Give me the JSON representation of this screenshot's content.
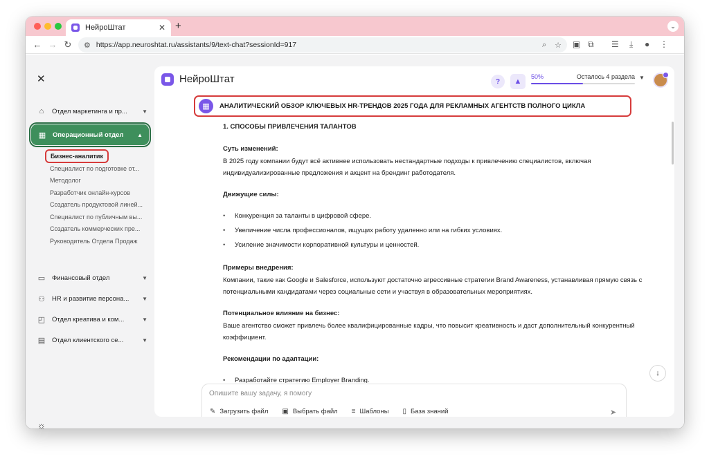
{
  "browser": {
    "tab_title": "НейроШтат",
    "tab_close": "✕",
    "new_tab": "+",
    "url": "https://app.neuroshtat.ru/assistants/9/text-chat?sessionId=917"
  },
  "sidebar": {
    "close_icon": "✕",
    "sections": [
      {
        "label": "Отдел маркетинга и пр...",
        "icon": "shop-icon"
      },
      {
        "label": "Операционный отдел",
        "icon": "grid-icon",
        "active": true
      },
      {
        "label": "Финансовый отдел",
        "icon": "wallet-icon"
      },
      {
        "label": "HR и развитие персона...",
        "icon": "people-icon"
      },
      {
        "label": "Отдел креатива и ком...",
        "icon": "chat-icon"
      },
      {
        "label": "Отдел клиентского се...",
        "icon": "id-card-icon"
      }
    ],
    "sub_items": [
      {
        "label": "Бизнес-аналитик",
        "active": true
      },
      {
        "label": "Специалист по подготовке от..."
      },
      {
        "label": "Методолог"
      },
      {
        "label": "Разработчик онлайн-курсов"
      },
      {
        "label": "Создатель продуктовой линей..."
      },
      {
        "label": "Специалист по публичным вы..."
      },
      {
        "label": "Создатель коммерческих пре..."
      },
      {
        "label": "Руководитель Отдела Продаж"
      }
    ]
  },
  "header": {
    "app_name": "НейроШтат",
    "progress_percent": "50%",
    "progress_fraction": 0.5,
    "progress_remaining": "Осталось 4 раздела",
    "help_glyph": "?"
  },
  "document": {
    "title": "АНАЛИТИЧЕСКИЙ ОБЗОР КЛЮЧЕВЫХ HR-ТРЕНДОВ 2025 ГОДА ДЛЯ РЕКЛАМНЫХ АГЕНТСТВ ПОЛНОГО ЦИКЛА",
    "section_heading": "1. СПОСОБЫ ПРИВЛЕЧЕНИЯ ТАЛАНТОВ",
    "changes_label": "Суть изменений:",
    "changes_text": "В 2025 году компании будут всё активнее использовать нестандартные подходы к привлечению специалистов, включая индивидуализированные предложения и акцент на брендинг работодателя.",
    "drivers_label": "Движущие силы:",
    "drivers": [
      "Конкуренция за таланты в цифровой сфере.",
      "Увеличение числа профессионалов, ищущих работу удаленно или на гибких условиях.",
      "Усиление значимости корпоративной культуры и ценностей."
    ],
    "examples_label": "Примеры внедрения:",
    "examples_text": "Компании, такие как Google и Salesforce, используют достаточно агрессивные стратегии Brand Awareness, устанавливая прямую связь с потенциальными кандидатами через социальные сети и участвуя в образовательных мероприятиях.",
    "impact_label": "Потенциальное влияние на бизнес:",
    "impact_text": "Ваше агентство сможет привлечь более квалифицированные кадры, что повысит креативность и даст дополнительный конкурентный коэффициент.",
    "recommendations_label": "Рекомендации по адаптации:",
    "recommendations": [
      "Разработайте стратегию Employer Branding."
    ]
  },
  "composer": {
    "placeholder": "Опишите вашу задачу, я помогу",
    "upload_file": "Загрузить файл",
    "choose_file": "Выбрать файл",
    "templates": "Шаблоны",
    "knowledge_base": "База знаний"
  },
  "colors": {
    "accent": "#6b4de6",
    "sidebar_active": "#3e8f5c",
    "highlight_border": "#d63b3b",
    "tab_strip": "#f7c8cf"
  }
}
